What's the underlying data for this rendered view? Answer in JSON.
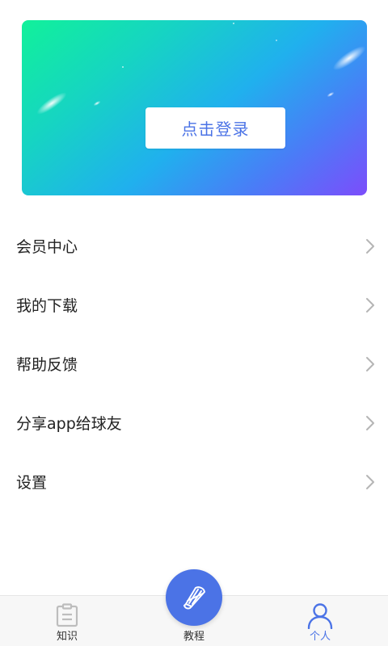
{
  "banner": {
    "login_label": "点击登录"
  },
  "menu": {
    "items": [
      {
        "label": "会员中心",
        "name": "menu-item-member-center"
      },
      {
        "label": "我的下载",
        "name": "menu-item-my-downloads"
      },
      {
        "label": "帮助反馈",
        "name": "menu-item-help-feedback"
      },
      {
        "label": "分享app给球友",
        "name": "menu-item-share-app"
      },
      {
        "label": "设置",
        "name": "menu-item-settings"
      }
    ]
  },
  "bottom_nav": {
    "knowledge_label": "知识",
    "tutorial_label": "教程",
    "personal_label": "个人",
    "active": "个人"
  },
  "colors": {
    "accent": "#4b73e6",
    "banner_start": "#11f19a",
    "banner_end": "#7c4dfb"
  },
  "icons": {
    "knowledge": "clipboard-icon",
    "tutorial": "shuttlecock-icon",
    "personal": "person-icon",
    "menu_arrow": "chevron-right-icon"
  }
}
